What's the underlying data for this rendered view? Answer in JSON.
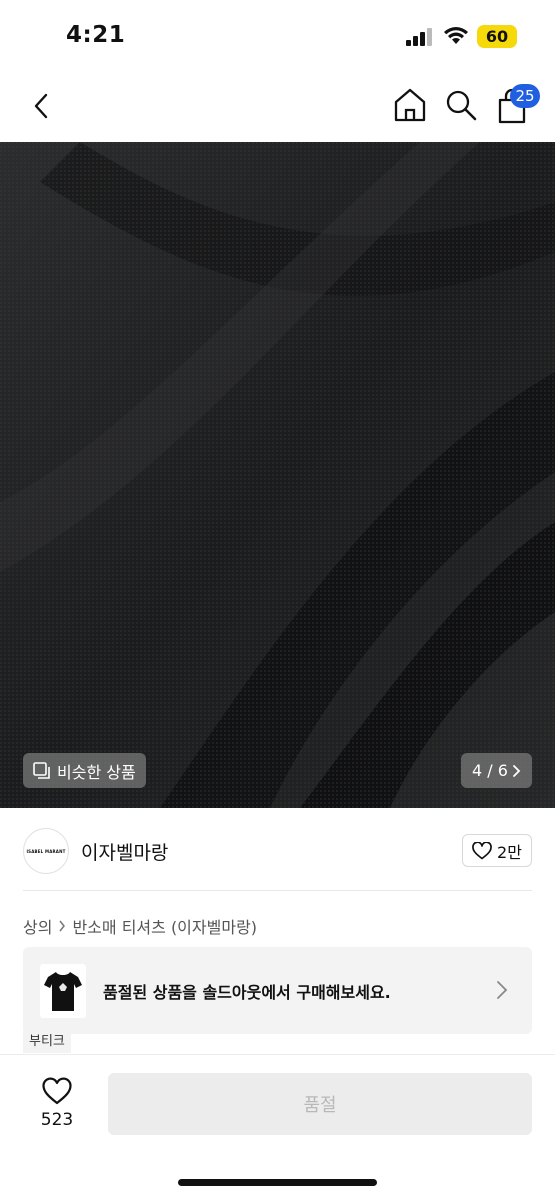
{
  "status_bar": {
    "time": "4:21",
    "battery": "60",
    "icons": [
      "signal-icon",
      "wifi-icon",
      "battery-icon"
    ]
  },
  "nav": {
    "icons": [
      "back-icon",
      "home-icon",
      "search-icon",
      "cart-icon"
    ],
    "cart_badge": "25",
    "badge_color": "#1f5fe0"
  },
  "gallery": {
    "similar_label": "비슷한 상품",
    "page_indicator": "4 / 6"
  },
  "brand": {
    "logo_text": "ISABEL MARANT",
    "name": "이자벨마랑",
    "likes": "2만"
  },
  "breadcrumb": [
    "상의",
    "반소매 티셔츠 (이자벨마랑)"
  ],
  "soldout_banner": {
    "text": "품절된 상품을 솔드아웃에서 구매해보세요."
  },
  "boutique_tag": "부티크",
  "bottom_bar": {
    "wish_count": "523",
    "soldout_label": "품절"
  }
}
